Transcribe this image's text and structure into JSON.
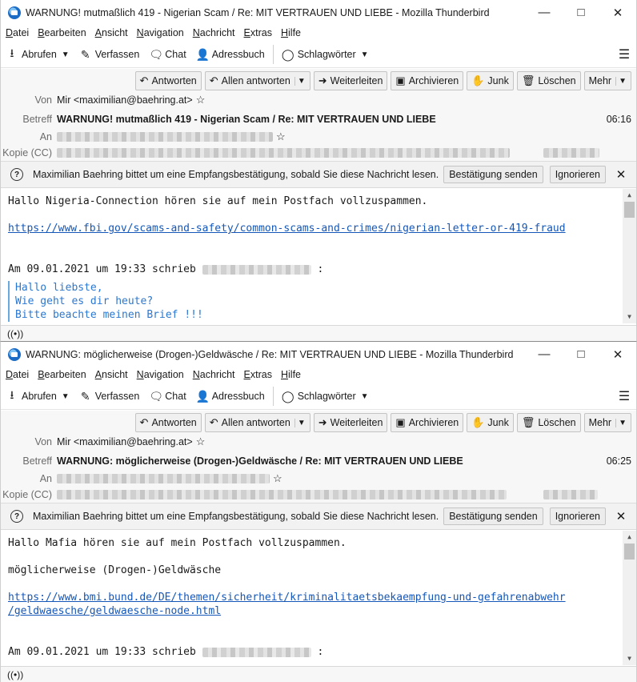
{
  "windows": [
    {
      "title": "WARNUNG! mutmaßlich 419 - Nigerian Scam / Re: MIT VERTRAUEN UND LIEBE - Mozilla Thunderbird",
      "menu": [
        "Datei",
        "Bearbeiten",
        "Ansicht",
        "Navigation",
        "Nachricht",
        "Extras",
        "Hilfe"
      ],
      "toolbar": {
        "abrufen": "Abrufen",
        "verfassen": "Verfassen",
        "chat": "Chat",
        "adressbuch": "Adressbuch",
        "schlagwoerter": "Schlagwörter"
      },
      "actions": {
        "reply": "Antworten",
        "reply_all": "Allen antworten",
        "forward": "Weiterleiten",
        "archive": "Archivieren",
        "junk": "Junk",
        "delete": "Löschen",
        "more": "Mehr"
      },
      "header": {
        "from_label": "Von",
        "from_value": "Mir <maximilian@baehring.at>",
        "subject_label": "Betreff",
        "subject_value": "WARNUNG! mutmaßlich 419 - Nigerian Scam / Re: MIT VERTRAUEN UND LIEBE",
        "time": "06:16",
        "to_label": "An",
        "cc_label": "Kopie (CC)"
      },
      "notification": {
        "text": "Maximilian Baehring bittet um eine Empfangsbestätigung, sobald Sie diese Nachricht lesen.",
        "send": "Bestätigung senden",
        "ignore": "Ignorieren"
      },
      "body": {
        "line1": "Hallo Nigeria-Connection hören sie auf mein Postfach vollzuspammen.",
        "link": "https://www.fbi.gov/scams-and-safety/common-scams-and-crimes/nigerian-letter-or-419-fraud",
        "quote_intro_pre": "Am 09.01.2021 um 19:33 schrieb",
        "quote_intro_post": ":",
        "quote": [
          "Hallo liebste,",
          "Wie geht es dir heute?",
          "Bitte beachte meinen Brief !!!"
        ]
      }
    },
    {
      "title": "WARNUNG: möglicherweise (Drogen-)Geldwäsche / Re: MIT VERTRAUEN UND LIEBE - Mozilla Thunderbird",
      "menu": [
        "Datei",
        "Bearbeiten",
        "Ansicht",
        "Navigation",
        "Nachricht",
        "Extras",
        "Hilfe"
      ],
      "toolbar": {
        "abrufen": "Abrufen",
        "verfassen": "Verfassen",
        "chat": "Chat",
        "adressbuch": "Adressbuch",
        "schlagwoerter": "Schlagwörter"
      },
      "actions": {
        "reply": "Antworten",
        "reply_all": "Allen antworten",
        "forward": "Weiterleiten",
        "archive": "Archivieren",
        "junk": "Junk",
        "delete": "Löschen",
        "more": "Mehr"
      },
      "header": {
        "from_label": "Von",
        "from_value": "Mir <maximilian@baehring.at>",
        "subject_label": "Betreff",
        "subject_value": "WARNUNG: möglicherweise (Drogen-)Geldwäsche / Re: MIT VERTRAUEN UND LIEBE",
        "time": "06:25",
        "to_label": "An",
        "cc_label": "Kopie (CC)"
      },
      "notification": {
        "text": "Maximilian Baehring bittet um eine Empfangsbestätigung, sobald Sie diese Nachricht lesen.",
        "send": "Bestätigung senden",
        "ignore": "Ignorieren"
      },
      "body": {
        "line1": "Hallo Mafia hören sie auf mein Postfach vollzuspammen.",
        "line2": "möglicherweise (Drogen-)Geldwäsche",
        "link_a": "https://www.bmi.bund.de/DE/themen/sicherheit/kriminalitaetsbekaempfung-und-gefahrenabwehr",
        "link_b": "/geldwaesche/geldwaesche-node.html",
        "quote_intro_pre": "Am 09.01.2021 um 19:33 schrieb",
        "quote_intro_post": ":"
      }
    }
  ],
  "colors": {
    "link": "#1457b8",
    "quote": "#2b78d0",
    "quote_bar": "#6aa8e0"
  },
  "icons": {
    "app": "thunderbird-icon",
    "status": "online-status-icon"
  }
}
